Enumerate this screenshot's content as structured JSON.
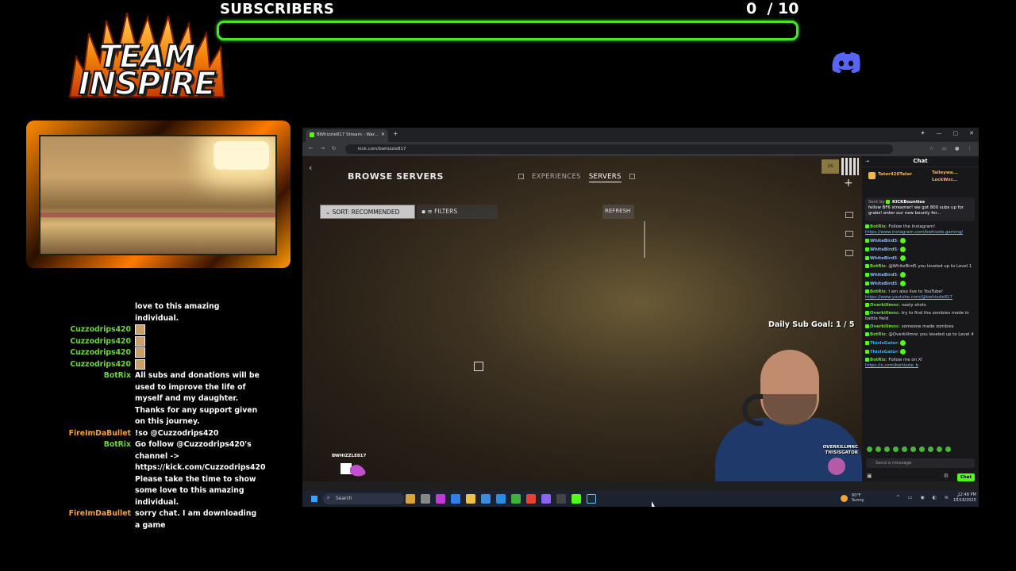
{
  "overlay": {
    "logo_line1": "TEAM",
    "logo_line2": "INSPIRE",
    "subscribers_label": "SUBSCRIBERS",
    "subscribers_count": "0  / 10",
    "subscribers_progress": 0,
    "accent_color": "#44e81f"
  },
  "overlay_chat": [
    {
      "user": "",
      "text": "love to this amazing individual.",
      "color": "#ffffff"
    },
    {
      "user": "Cuzzodrips420",
      "text": "",
      "color": "#6fd53a",
      "emote": true
    },
    {
      "user": "Cuzzodrips420",
      "text": "",
      "color": "#6fd53a",
      "emote": true
    },
    {
      "user": "Cuzzodrips420",
      "text": "",
      "color": "#6fd53a",
      "emote": true
    },
    {
      "user": "Cuzzodrips420",
      "text": "",
      "color": "#6fd53a",
      "emote": true
    },
    {
      "user": "BotRix",
      "text": "All subs and donations will be used to improve the life of myself and my daughter. Thanks for any support given on this journey.",
      "color": "#6fd53a"
    },
    {
      "user": "FireImDaBullet",
      "text": "!so @Cuzzodrips420",
      "color": "#f2a33a"
    },
    {
      "user": "BotRix",
      "text": "Go follow @Cuzzodrips420's channel -> https://kick.com/Cuzzodrips420 Please take the time to show some love to this amazing individual.",
      "color": "#6fd53a"
    },
    {
      "user": "FireImDaBullet",
      "text": "sorry chat. I am downloading a game",
      "color": "#f2a33a"
    }
  ],
  "browser": {
    "tab_title": "BWhizzle817 Stream - War...",
    "url": "kick.com/bwhizzle817"
  },
  "game": {
    "title": "BROWSE SERVERS",
    "tab_experiences": "EXPERIENCES",
    "tab_servers": "SERVERS",
    "sort_label": "SORT: RECOMMENDED",
    "filters_label": "FILTERS",
    "refresh_label": "REFRESH",
    "sub_goal": "Daily Sub Goal: 1 / 5",
    "streamer_tag": "BWHIZZLE817",
    "alert_line1": "OVERKILLMNC",
    "alert_line2": "THISISGATOR"
  },
  "kick_chat": {
    "title": "Chat",
    "leaders": [
      "Tater420Tater",
      "Talleywa...",
      "LockWxr..."
    ],
    "pinned_by": "Sent by",
    "pinned_author": "KICKBounties",
    "pinned_text": "fellow BF6 streamer! we got 800 subs up for grabs! enter our new bounty for...",
    "messages": [
      {
        "user": "BotRix",
        "text": "Follow the Instagram!",
        "link": "https://www.instagram.com/bwhizzle.gaming/",
        "color": "#6fd53a"
      },
      {
        "user": "WhiteBird5",
        "text": "",
        "color": "#8ab4f8",
        "emote": true
      },
      {
        "user": "WhiteBird5",
        "text": "",
        "color": "#8ab4f8",
        "emote": true
      },
      {
        "user": "WhiteBird5",
        "text": "",
        "color": "#8ab4f8",
        "emote": true
      },
      {
        "user": "BotRix",
        "text": "@WhiteBird5 you leveled up to Level 1",
        "color": "#6fd53a"
      },
      {
        "user": "WhiteBird5",
        "text": "",
        "color": "#8ab4f8",
        "emote": true
      },
      {
        "user": "WhiteBird5",
        "text": "",
        "color": "#8ab4f8",
        "emote": true
      },
      {
        "user": "BotRix",
        "text": "I am also live to YouTube!",
        "link": "https://www.youtube.com/@bwhizzle817",
        "color": "#6fd53a"
      },
      {
        "user": "Overkillmnc",
        "text": "nasty shots",
        "color": "#6fd53a"
      },
      {
        "user": "Overkillmnc",
        "text": "try to find the zombies mode in battle field",
        "color": "#6fd53a"
      },
      {
        "user": "Overkillmnc",
        "text": "someone made zombies",
        "color": "#6fd53a"
      },
      {
        "user": "BotRix",
        "text": "@Overkillmnc you leveled up to Level 4",
        "color": "#6fd53a"
      },
      {
        "user": "ThisIsGator",
        "text": "",
        "color": "#3ab0e8",
        "emote": true
      },
      {
        "user": "ThisIsGator",
        "text": "",
        "color": "#3ab0e8",
        "emote": true
      },
      {
        "user": "BotRix",
        "text": "Follow me on X!",
        "link": "https://x.com/bwhizzle_b",
        "color": "#6fd53a"
      }
    ],
    "input_placeholder": "Send a message",
    "send_label": "Chat"
  },
  "taskbar": {
    "search_label": "Search",
    "weather_temp": "60°F",
    "weather_desc": "Sunny",
    "time": "12:48 PM",
    "date": "10/16/2025"
  }
}
